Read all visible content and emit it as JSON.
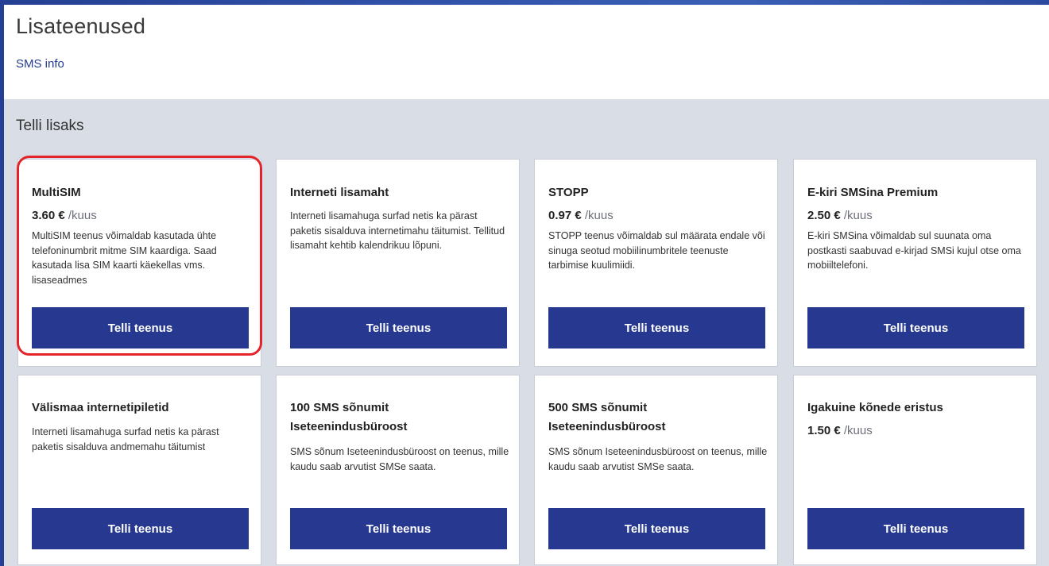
{
  "header": {
    "title": "Lisateenused",
    "link": "SMS info"
  },
  "section": {
    "title": "Telli lisaks"
  },
  "button_label": "Telli teenus",
  "cards": [
    {
      "title": "MultiSIM",
      "price": "3.60 €",
      "unit": "/kuus",
      "description": "MultiSIM teenus võimaldab kasutada ühte telefoninumbrit mitme SIM kaardiga. Saad kasutada lisa SIM kaarti käekellas vms. lisaseadmes"
    },
    {
      "title": "Interneti lisamaht",
      "description": "Interneti lisamahuga surfad netis ka pärast paketis sisalduva internetimahu täitumist. Tellitud lisamaht kehtib kalendrikuu lõpuni."
    },
    {
      "title": "STOPP",
      "price": "0.97 €",
      "unit": "/kuus",
      "description": "STOPP teenus võimaldab sul määrata endale või sinuga seotud mobiilinumbritele teenuste tarbimise kuulimiidi."
    },
    {
      "title": "E-kiri SMSina Premium",
      "price": "2.50 €",
      "unit": "/kuus",
      "description": "E-kiri SMSina võimaldab sul suunata oma postkasti saabuvad e-kirjad SMSi kujul otse oma mobiiltelefoni."
    },
    {
      "title": "Välismaa internetipiletid",
      "description": "Interneti lisamahuga surfad netis ka pärast paketis sisalduva andmemahu täitumist"
    },
    {
      "title": "100 SMS sõnumit Iseteenindusbüroost",
      "description": "SMS sõnum Iseteenindusbüroost on teenus, mille kaudu saab arvutist SMSe saata."
    },
    {
      "title": "500 SMS sõnumit Iseteenindusbüroost",
      "description": "SMS sõnum Iseteenindusbüroost on teenus, mille kaudu saab arvutist SMSe saata."
    },
    {
      "title": "Igakuine kõnede eristus",
      "price": "1.50 €",
      "unit": "/kuus"
    }
  ],
  "colors": {
    "button": "#26388f",
    "section_bg": "#d9dde6",
    "highlight": "#e3242b"
  }
}
